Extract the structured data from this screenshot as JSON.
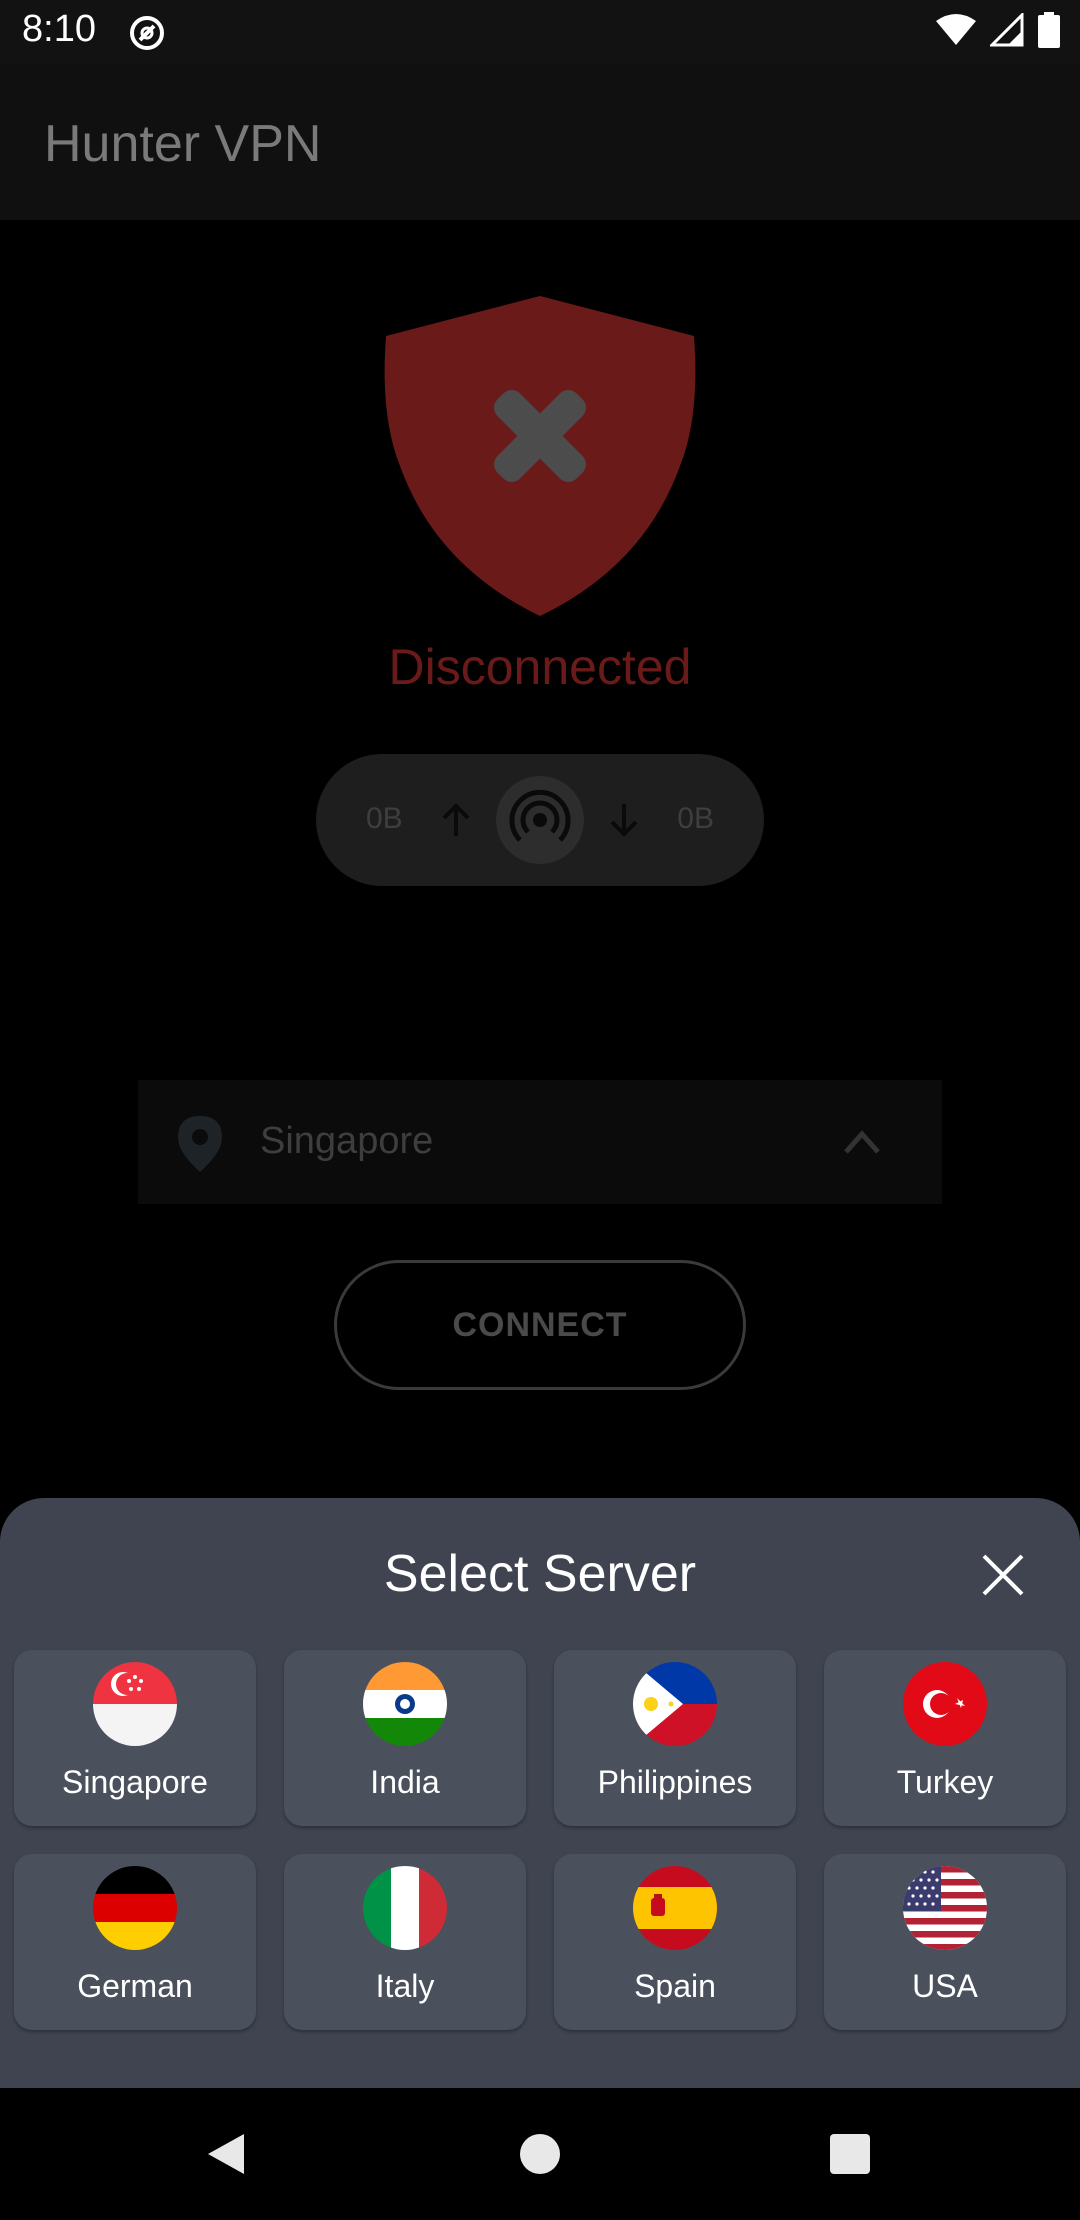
{
  "status_bar": {
    "time": "8:10"
  },
  "app": {
    "title": "Hunter VPN"
  },
  "connection": {
    "status": "Disconnected",
    "upload": "0B",
    "download": "0B"
  },
  "server_select": {
    "selected": "Singapore"
  },
  "connect_button": {
    "label": "CONNECT"
  },
  "sheet": {
    "title": "Select Server",
    "servers": [
      {
        "label": "Singapore"
      },
      {
        "label": "India"
      },
      {
        "label": "Philippines"
      },
      {
        "label": "Turkey"
      },
      {
        "label": "German"
      },
      {
        "label": "Italy"
      },
      {
        "label": "Spain"
      },
      {
        "label": "USA"
      }
    ]
  },
  "colors": {
    "sheet_bg": "#3f4450",
    "card_bg": "#4a505c",
    "shield_red": "#6b1a1a"
  }
}
